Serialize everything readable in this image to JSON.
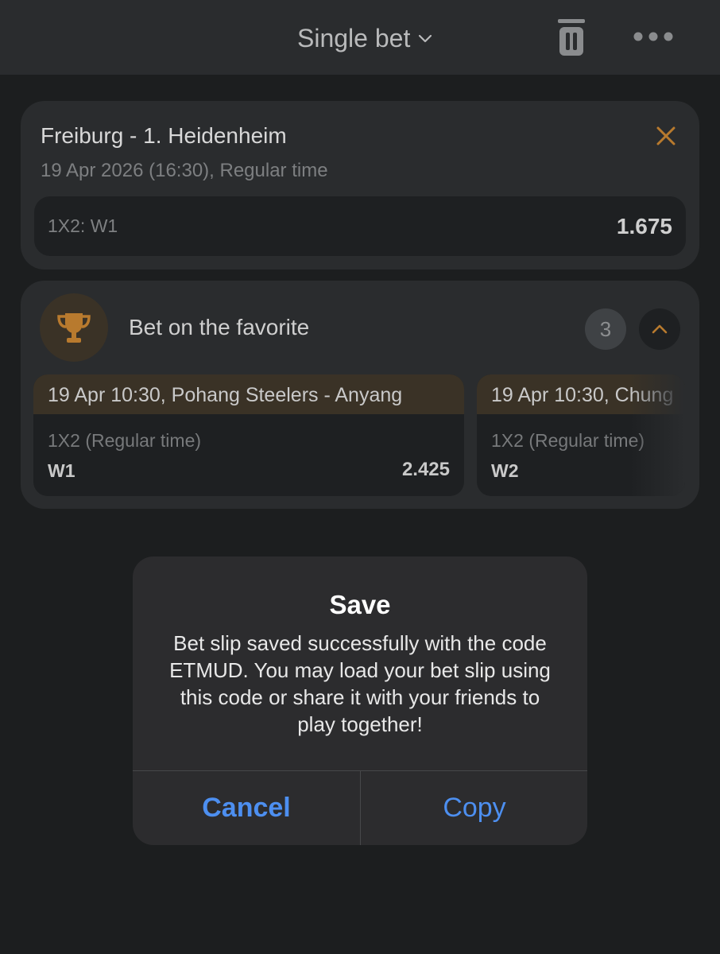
{
  "header": {
    "title": "Single bet"
  },
  "main_bet": {
    "match": "Freiburg - 1. Heidenheim",
    "datetime": "19 Apr 2026 (16:30), Regular time",
    "outcome": "1X2: W1",
    "odds": "1.675"
  },
  "favorite": {
    "title": "Bet on the favorite",
    "count": "3",
    "events": [
      {
        "header": "19 Apr 10:30, Pohang Steelers - Anyang",
        "market": "1X2 (Regular time)",
        "outcome": "W1",
        "odds": "2.425"
      },
      {
        "header": "19 Apr 10:30, Chung",
        "market": "1X2 (Regular time)",
        "outcome": "W2"
      }
    ]
  },
  "dialog": {
    "title": "Save",
    "message": "Bet slip saved successfully with the code ETMUD. You may load your bet slip using this code or share it with your friends to play together!",
    "cancel_label": "Cancel",
    "copy_label": "Copy"
  },
  "colors": {
    "accent_orange": "#b87a2e",
    "link_blue": "#4d8ff0",
    "background": "#1c1e1f",
    "card": "#2a2c2e"
  },
  "icons": {
    "dropdown": "chevron-down-icon",
    "delete": "trash-icon",
    "menu": "more-icon",
    "close": "close-icon",
    "trophy": "trophy-icon",
    "collapse": "chevron-up-icon"
  }
}
